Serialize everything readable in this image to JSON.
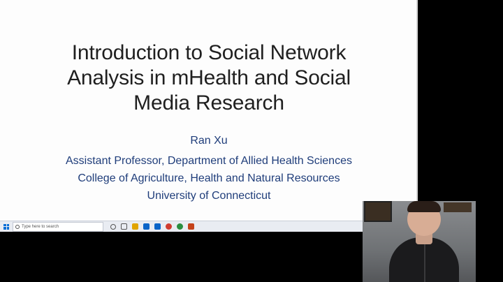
{
  "slide": {
    "title_lines": [
      "Introduction to Social Network",
      "Analysis in mHealth and Social",
      "Media Research"
    ],
    "author": "Ran Xu",
    "affiliation_lines": [
      "Assistant Professor, Department of Allied Health Sciences",
      "College of Agriculture, Health and Natural Resources",
      "University of Connecticut"
    ]
  },
  "taskbar": {
    "search_placeholder": "Type here to search",
    "icons": [
      "task-view-icon",
      "cortana-icon",
      "file-explorer-icon",
      "outlook-icon",
      "store-icon",
      "chrome-icon",
      "edge-icon",
      "powerpoint-icon"
    ],
    "icon_colors": [
      "#555555",
      "#555555",
      "#e0a400",
      "#0a64c8",
      "#0a64c8",
      "#d03c2f",
      "#2a8e3f",
      "#c4421a"
    ],
    "tray_glyphs": "^ ▭ ◂)"
  },
  "webcam": {
    "label": "presenter-webcam"
  }
}
